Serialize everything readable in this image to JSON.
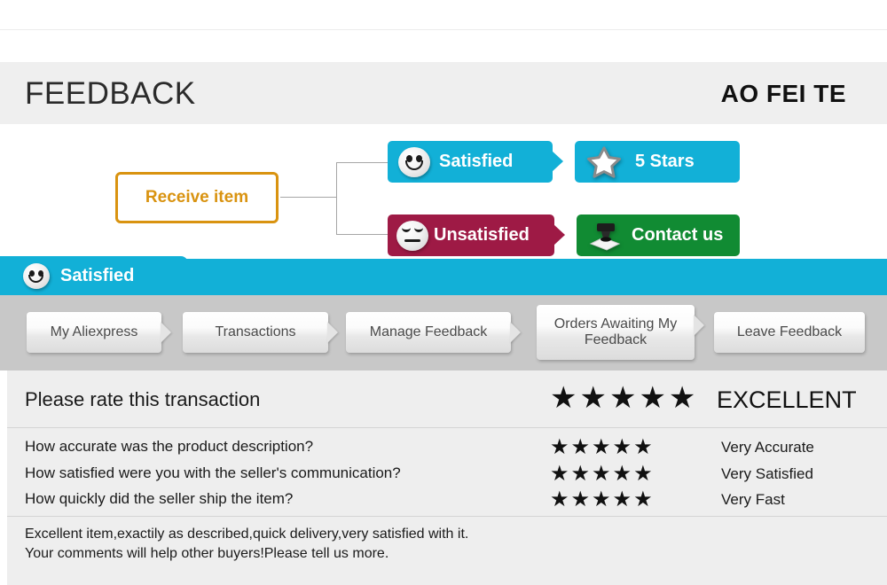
{
  "header": {
    "title": "FEEDBACK",
    "brand": "AO FEI TE"
  },
  "flow": {
    "start_node": "Receive item",
    "satisfied": {
      "label": "Satisfied",
      "icon": "smiley-face-icon",
      "color": "#12b0d7"
    },
    "five_stars": {
      "label": "5 Stars",
      "icon": "star-icon",
      "color": "#12b0d7"
    },
    "unsatisfied": {
      "label": "Unsatisfied",
      "icon": "sad-face-icon",
      "color": "#9e1a45"
    },
    "contact": {
      "label": "Contact us",
      "icon": "stamp-icon",
      "color": "#118b33"
    }
  },
  "tab": {
    "label": "Satisfied",
    "icon": "smiley-face-icon",
    "color": "#12b0d7"
  },
  "breadcrumb": {
    "items": [
      {
        "label": "My Aliexpress"
      },
      {
        "label": "Transactions"
      },
      {
        "label": "Manage Feedback"
      },
      {
        "label": "Orders Awaiting My Feedback"
      },
      {
        "label": "Leave Feedback"
      }
    ]
  },
  "rating": {
    "title": "Please rate this transaction",
    "overall_stars": "★★★★★",
    "overall_word": "EXCELLENT",
    "questions": [
      {
        "question": "How accurate was the product description?",
        "stars": "★★★★★",
        "answer": "Very Accurate"
      },
      {
        "question": "How satisfied were you with the seller's communication?",
        "stars": "★★★★★",
        "answer": "Very Satisfied"
      },
      {
        "question": "How quickly did the seller ship the item?",
        "stars": "★★★★★",
        "answer": "Very Fast"
      }
    ],
    "comment_line_1": "Excellent item,exactily as described,quick delivery,very satisfied with it.",
    "comment_line_2": "Your comments will help other buyers!Please tell us more."
  }
}
